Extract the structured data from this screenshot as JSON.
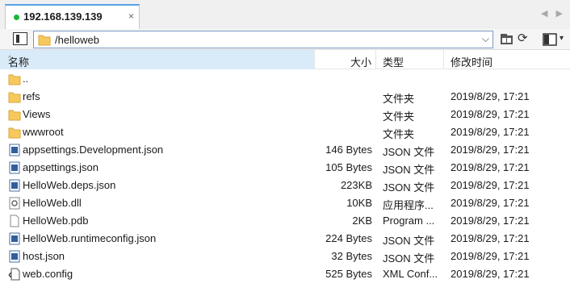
{
  "tab": {
    "title": "192.168.139.139",
    "close": "×",
    "status_color": "#1fb33a"
  },
  "tab_scroll": {
    "left": "◀",
    "right": "▶"
  },
  "toolbar": {
    "path": "/helloweb",
    "dropdown": "⌵",
    "refresh": "⟳",
    "view_dropdown": "▾"
  },
  "columns": {
    "name": "名称",
    "sort": "^",
    "size": "大小",
    "type": "类型",
    "date": "修改时间"
  },
  "files": [
    {
      "icon": "folder-up-icon",
      "name": "..",
      "size": "",
      "type": "",
      "date": ""
    },
    {
      "icon": "folder-icon",
      "name": "refs",
      "size": "",
      "type": "文件夹",
      "date": "2019/8/29, 17:21"
    },
    {
      "icon": "folder-icon",
      "name": "Views",
      "size": "",
      "type": "文件夹",
      "date": "2019/8/29, 17:21"
    },
    {
      "icon": "folder-icon",
      "name": "wwwroot",
      "size": "",
      "type": "文件夹",
      "date": "2019/8/29, 17:21"
    },
    {
      "icon": "json-file-icon",
      "name": "appsettings.Development.json",
      "size": "146 Bytes",
      "type": "JSON 文件",
      "date": "2019/8/29, 17:21"
    },
    {
      "icon": "json-file-icon",
      "name": "appsettings.json",
      "size": "105 Bytes",
      "type": "JSON 文件",
      "date": "2019/8/29, 17:21"
    },
    {
      "icon": "json-file-icon",
      "name": "HelloWeb.deps.json",
      "size": "223KB",
      "type": "JSON 文件",
      "date": "2019/8/29, 17:21"
    },
    {
      "icon": "dll-file-icon",
      "name": "HelloWeb.dll",
      "size": "10KB",
      "type": "应用程序...",
      "date": "2019/8/29, 17:21"
    },
    {
      "icon": "file-icon",
      "name": "HelloWeb.pdb",
      "size": "2KB",
      "type": "Program ...",
      "date": "2019/8/29, 17:21"
    },
    {
      "icon": "json-file-icon",
      "name": "HelloWeb.runtimeconfig.json",
      "size": "224 Bytes",
      "type": "JSON 文件",
      "date": "2019/8/29, 17:21"
    },
    {
      "icon": "json-file-icon",
      "name": "host.json",
      "size": "32 Bytes",
      "type": "JSON 文件",
      "date": "2019/8/29, 17:21"
    },
    {
      "icon": "xml-config-file-icon",
      "name": "web.config",
      "size": "525 Bytes",
      "type": "XML Conf...",
      "date": "2019/8/29, 17:21"
    }
  ]
}
